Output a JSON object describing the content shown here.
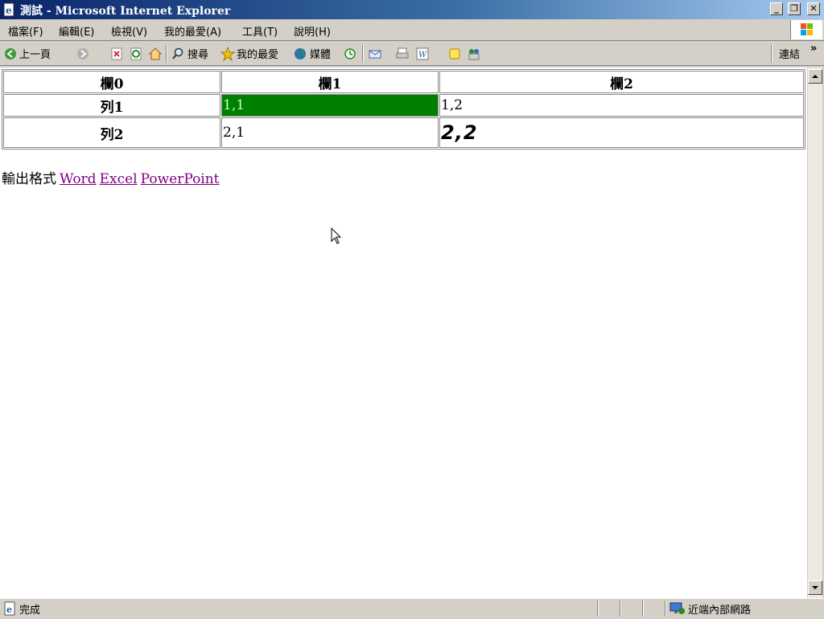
{
  "window": {
    "title": "測試 - Microsoft Internet Explorer",
    "minimize": "_",
    "restore": "❐",
    "close": "✕"
  },
  "menu": [
    "檔案(F)",
    "編輯(E)",
    "檢視(V)",
    "我的最愛(A)",
    "工具(T)",
    "說明(H)"
  ],
  "toolbar": {
    "back_label": "上一頁",
    "search_label": "搜尋",
    "favorites_label": "我的最愛",
    "media_label": "媒體",
    "links_label": "連結",
    "more_label": "»"
  },
  "table": {
    "headers": [
      "欄0",
      "欄1",
      "欄2"
    ],
    "rows": [
      {
        "label": "列1",
        "cells": [
          "1,1",
          "1,2"
        ]
      },
      {
        "label": "列2",
        "cells": [
          "2,1",
          "2,2"
        ]
      }
    ]
  },
  "export": {
    "label": "輸出格式",
    "links": [
      "Word",
      "Excel",
      "PowerPoint"
    ]
  },
  "status": {
    "text": "完成",
    "zone": "近端內部網路"
  },
  "colors": {
    "titlebar_start": "#0a246a",
    "highlight_cell": "#008000",
    "visited_link": "#800080"
  }
}
